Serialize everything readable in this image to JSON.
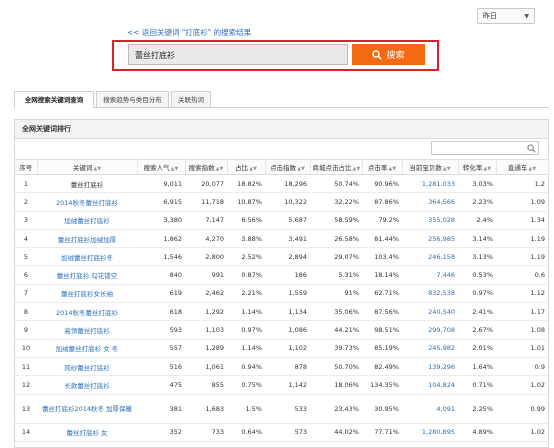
{
  "date_select": {
    "value": "昨日"
  },
  "back_link": "<< 返回关键词 \"打底衫\" 的搜索结果",
  "search": {
    "value": "蕾丝打底衫",
    "button": "搜索"
  },
  "tabs": [
    {
      "label": "全网搜索关键词查询",
      "active": true
    },
    {
      "label": "搜索趋势与类目分布",
      "active": false
    },
    {
      "label": "关联热词",
      "active": false
    }
  ],
  "panel": {
    "title": "全网关键词排行"
  },
  "table": {
    "headers": [
      "序号",
      "关键词",
      "搜索人气",
      "搜索指数",
      "占比",
      "点击指数",
      "商城点击占比",
      "点击率",
      "当前宝贝数",
      "转化率",
      "直通车"
    ],
    "rows": [
      [
        "1",
        "蕾丝打底衫",
        "9,011",
        "20,077",
        "18.82%",
        "18,296",
        "50.74%",
        "90.96%",
        "1,281,033",
        "3.03%",
        "1.2"
      ],
      [
        "2",
        "2014秋冬蕾丝打底衫",
        "6,915",
        "11,718",
        "10.87%",
        "10,322",
        "32.22%",
        "87.86%",
        "364,566",
        "2.23%",
        "1.09"
      ],
      [
        "3",
        "加绒蕾丝打底衫",
        "3,380",
        "7,147",
        "6.56%",
        "5,687",
        "58.59%",
        "79.2%",
        "355,028",
        "2.4%",
        "1.34"
      ],
      [
        "4",
        "蕾丝打底衫加绒加厚",
        "1,862",
        "4,270",
        "3.88%",
        "3,491",
        "26.58%",
        "81.44%",
        "256,985",
        "3.14%",
        "1.19"
      ],
      [
        "5",
        "加绒蕾丝打底衫冬",
        "1,546",
        "2,800",
        "2.52%",
        "2,894",
        "29.07%",
        "103.4%",
        "246,158",
        "3.13%",
        "1.19"
      ],
      [
        "6",
        "蕾丝打底衫 勾花镂空",
        "840",
        "991",
        "0.87%",
        "186",
        "5.31%",
        "18.14%",
        "7,446",
        "0.53%",
        "0.6"
      ],
      [
        "7",
        "蕾丝打底衫女长袖",
        "619",
        "2,462",
        "2.21%",
        "1,559",
        "91%",
        "62.71%",
        "832,538",
        "0.97%",
        "1.12"
      ],
      [
        "8",
        "2014秋冬蕾丝打底衫",
        "618",
        "1,292",
        "1.14%",
        "1,134",
        "35.06%",
        "87.56%",
        "240,540",
        "2.41%",
        "1.17"
      ],
      [
        "9",
        "高领蕾丝打底衫",
        "593",
        "1,103",
        "0.97%",
        "1,086",
        "44.21%",
        "98.51%",
        "299,708",
        "2.67%",
        "1.08"
      ],
      [
        "10",
        "加绒蕾丝打底衫 女 冬",
        "557",
        "1,289",
        "1.14%",
        "1,102",
        "39.73%",
        "85.19%",
        "245,982",
        "2.01%",
        "1.01"
      ],
      [
        "11",
        "冈纱蕾丝打底衫",
        "516",
        "1,061",
        "0.94%",
        "878",
        "50.70%",
        "82.49%",
        "139,296",
        "1.64%",
        "0.9"
      ],
      [
        "12",
        "长款蕾丝打底衫",
        "475",
        "855",
        "0.75%",
        "1,142",
        "18.06%",
        "134.35%",
        "104,824",
        "0.71%",
        "1.02"
      ],
      [
        "13",
        "蕾丝打底衫2014秋冬 加厚保暖",
        "381",
        "1,683",
        "1.5%",
        "533",
        "23.43%",
        "30.95%",
        "4,091",
        "2.25%",
        "0.99"
      ],
      [
        "14",
        "蕾丝打底衫 女",
        "352",
        "733",
        "0.64%",
        "573",
        "44.02%",
        "77.71%",
        "1,280,895",
        "4.89%",
        "1.02"
      ]
    ]
  }
}
